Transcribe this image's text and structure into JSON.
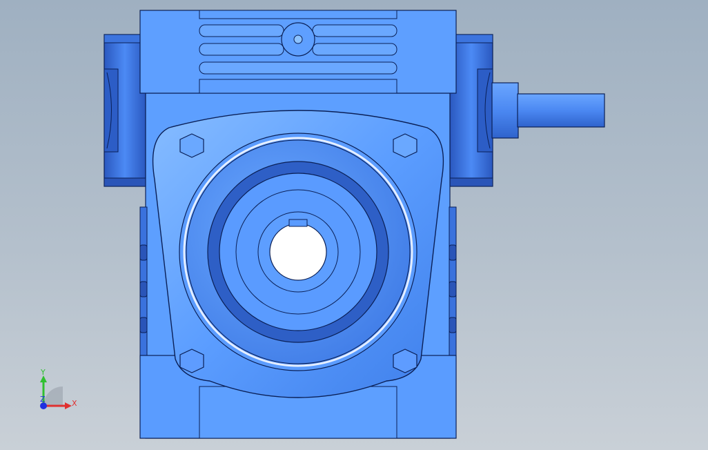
{
  "viewport": {
    "background_top": "#9fb0c1",
    "background_bottom": "#c9d0d7"
  },
  "model": {
    "body_color": "#5a9cff",
    "body_dark": "#2f62c8",
    "body_light": "#8cc2ff",
    "outline": "#0a1f55",
    "shaft_color": "#4a88f0"
  },
  "triad": {
    "x_label": "X",
    "y_label": "Y",
    "z_label": "Z",
    "x_color": "#e03030",
    "y_color": "#30c030",
    "z_color": "#2030e0"
  }
}
